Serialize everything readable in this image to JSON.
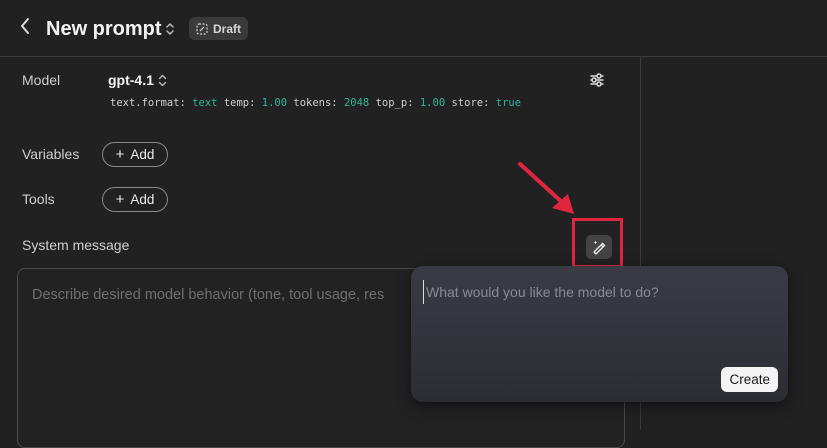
{
  "header": {
    "title": "New prompt",
    "badge": "Draft"
  },
  "model": {
    "label": "Model",
    "name": "gpt-4.1",
    "params": [
      {
        "key": "text.format:",
        "value": "text"
      },
      {
        "key": "temp:",
        "value": "1.00"
      },
      {
        "key": "tokens:",
        "value": "2048"
      },
      {
        "key": "top_p:",
        "value": "1.00"
      },
      {
        "key": "store:",
        "value": "true"
      }
    ]
  },
  "variables": {
    "label": "Variables",
    "add_label": "Add"
  },
  "tools": {
    "label": "Tools",
    "add_label": "Add"
  },
  "system": {
    "label": "System message",
    "placeholder": "Describe desired model behavior (tone, tool usage, res"
  },
  "popover": {
    "placeholder": "What would you like the model to do?",
    "create_label": "Create"
  },
  "colors": {
    "background": "#212121",
    "param_value": "#2fb59a",
    "highlight": "#e0263f"
  }
}
